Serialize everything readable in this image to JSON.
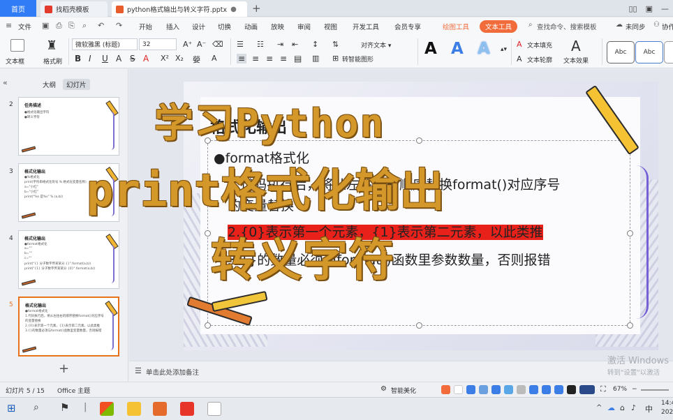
{
  "titlebar": {
    "home": "首页",
    "tab1": "找稻壳模板",
    "tab2": "python格式输出与转义字符.pptx"
  },
  "menu": {
    "file": "文件",
    "items": [
      "开始",
      "插入",
      "设计",
      "切换",
      "动画",
      "放映",
      "审阅",
      "视图",
      "开发工具",
      "会员专享"
    ],
    "drawing_tools": "绘图工具",
    "text_tools": "文本工具",
    "search": "查找命令、搜索模板",
    "sync": "未同步",
    "collab": "协作"
  },
  "ribbon": {
    "textbox_label": "文本框",
    "format_painter": "格式刷",
    "font_name": "微软雅黑 (标题)",
    "font_size": "32",
    "align_text": "对齐文本",
    "convert_smartart": "转智能图形",
    "text_fill": "文本填充",
    "text_outline": "文本轮廓",
    "text_effect": "文本效果",
    "style_a": "A",
    "shape_abc": "Abc"
  },
  "leftpanel": {
    "outline_tab": "大纲",
    "slides_tab": "幻灯片",
    "thumbs": [
      {
        "num": "2",
        "title": "任务描述",
        "lines": [
          "●格式化输出字符",
          "●转义字符"
        ]
      },
      {
        "num": "3",
        "title": "格式化输出",
        "lines": [
          "●%格式化",
          "print(字符串格式化符号 % 格式化变量名称)",
          "a=\"小红\"",
          "b=\"小红\"",
          "print(\"%s 是%s\" % (a,b))"
        ]
      },
      {
        "num": "4",
        "title": "格式化输出",
        "lines": [
          "●format格式化",
          "a=\"\"",
          "b=\"\"",
          "c=\"\"",
          "print(\"{} 分子数字传某某分 {}\".format(a,b))",
          "print(\"{1} 分子数字传某某分 {0}\".format(a,b))"
        ]
      },
      {
        "num": "5",
        "title": "格式化输出",
        "lines": [
          "●format格式化",
          "1.代码执行后，将从左往右的顺序替换format()对应序号",
          "的变量替换",
          "2.{0}表示第一个元素，{1}表示第二元素，以此类推",
          "3.{}的数量必须与format()函数里变量数量，否则报错"
        ]
      }
    ]
  },
  "slide": {
    "title": "格式化输出",
    "bullet": "●format格式化",
    "line1a": "1.代码执行后，将从左往右的顺序替换format()对应序号",
    "line1b": "的变量替换",
    "line2": "2.{0}表示第一个元素，{1}表示第二元素，以此类推",
    "line3": "3.{}的数量必须与format()函数里参数数量，否则报错"
  },
  "overlay": {
    "line1": "学习Python",
    "line2": "print格式化输出",
    "line3": "转义字符"
  },
  "notes": {
    "placeholder": "单击此处添加备注"
  },
  "watermark": {
    "line1": "激活 Windows",
    "line2": "转到\"设置\"以激活"
  },
  "status": {
    "slide_pos": "幻灯片 5 / 15",
    "theme": "Office 主题",
    "beautify": "智能美化",
    "zoom": "67%"
  },
  "taskbar": {
    "time": "14:4",
    "date": "202"
  },
  "colors": {
    "accent_orange": "#f26b3a",
    "home_blue": "#2f7cf6",
    "overlay_gold": "#d4982a",
    "highlight_red": "#e8211b"
  }
}
